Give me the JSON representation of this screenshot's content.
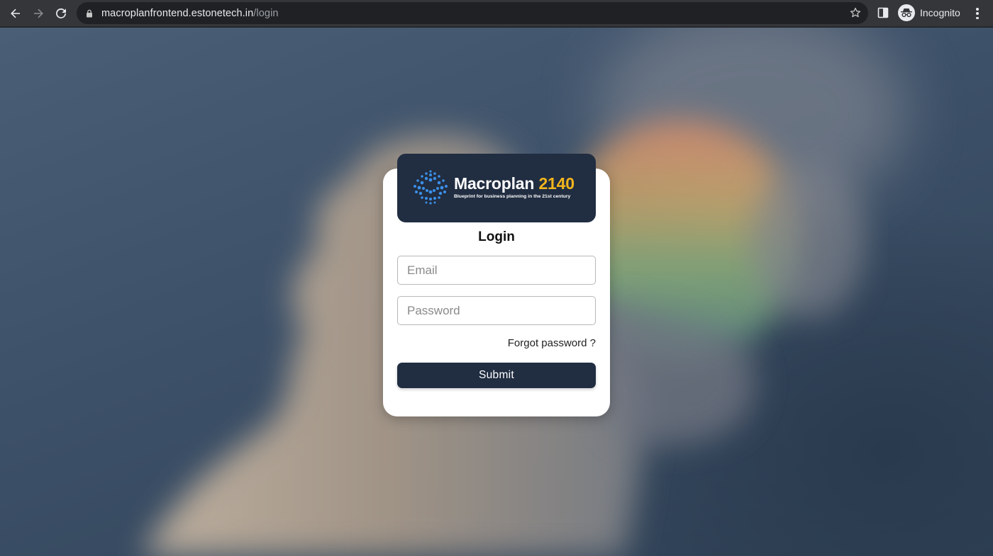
{
  "browser": {
    "url_host": "macroplanfrontend.estonetech.in",
    "url_path": "/login",
    "profile_label": "Incognito",
    "icons": [
      "back-arrow-icon",
      "forward-arrow-icon",
      "reload-icon",
      "lock-icon",
      "star-icon",
      "side-panel-icon",
      "incognito-icon",
      "more-vert-icon"
    ]
  },
  "brand": {
    "name": "Macroplan",
    "year": "2140",
    "tagline": "Blueprint for business planning in the 21st century",
    "colors": {
      "panel": "#212d41",
      "accent": "#f2b51d",
      "dots": "#3b8fe8"
    }
  },
  "login": {
    "title": "Login",
    "email_placeholder": "Email",
    "password_placeholder": "Password",
    "forgot_label": "Forgot password ?",
    "submit_label": "Submit"
  }
}
